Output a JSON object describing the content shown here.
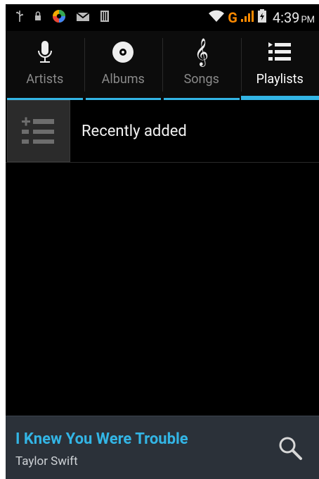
{
  "status_bar": {
    "time": "4:39",
    "ampm": "PM",
    "network": "G",
    "icons_left": [
      "usb-icon",
      "lock-icon",
      "app-icon",
      "mail-icon",
      "sd-card-icon"
    ],
    "icons_right": [
      "wifi-icon",
      "network-type-icon",
      "signal-icon",
      "battery-icon"
    ]
  },
  "tabs": [
    {
      "label": "Artists",
      "icon": "microphone-icon",
      "active": false
    },
    {
      "label": "Albums",
      "icon": "disc-icon",
      "active": false
    },
    {
      "label": "Songs",
      "icon": "music-note-icon",
      "active": false
    },
    {
      "label": "Playlists",
      "icon": "playlist-icon",
      "active": true
    }
  ],
  "playlists": [
    {
      "label": "Recently added",
      "icon": "add-playlist-icon"
    }
  ],
  "now_playing": {
    "title": "I Knew You Were Trouble",
    "artist": "Taylor Swift"
  },
  "colors": {
    "accent": "#33b5e5",
    "background": "#000000",
    "now_playing_bg": "#2b3139"
  }
}
